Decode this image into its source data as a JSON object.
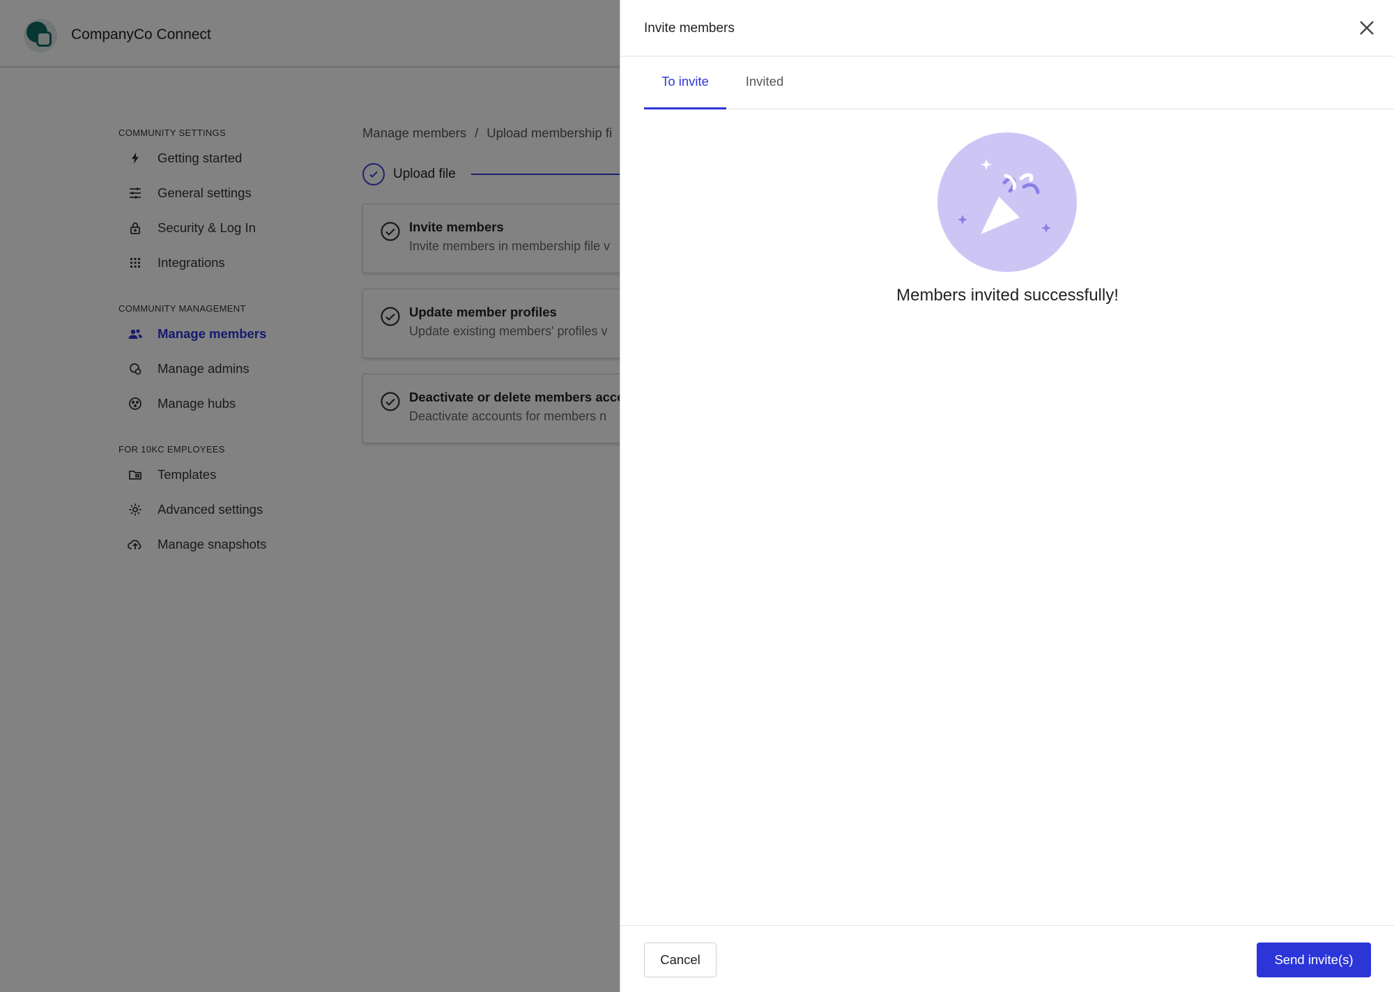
{
  "app": {
    "title": "CompanyCo Connect",
    "logo_icon": "chat-bubbles-logo",
    "accent_color": "#2c35d8"
  },
  "sidebar": {
    "sections": [
      {
        "heading": "COMMUNITY SETTINGS",
        "items": [
          {
            "label": "Getting started",
            "icon": "lightning-icon"
          },
          {
            "label": "General settings",
            "icon": "sliders-icon"
          },
          {
            "label": "Security & Log In",
            "icon": "lock-icon"
          },
          {
            "label": "Integrations",
            "icon": "grid-icon"
          }
        ]
      },
      {
        "heading": "COMMUNITY MANAGEMENT",
        "items": [
          {
            "label": "Manage members",
            "icon": "users-icon",
            "active": true
          },
          {
            "label": "Manage admins",
            "icon": "admin-badge-icon"
          },
          {
            "label": "Manage hubs",
            "icon": "hub-icon"
          }
        ]
      },
      {
        "heading": "FOR 10KC EMPLOYEES",
        "items": [
          {
            "label": "Templates",
            "icon": "folder-icon"
          },
          {
            "label": "Advanced settings",
            "icon": "gear-icon"
          },
          {
            "label": "Manage snapshots",
            "icon": "cloud-upload-icon"
          }
        ]
      }
    ]
  },
  "main": {
    "breadcrumb": [
      "Manage members",
      "/",
      "Upload membership fi"
    ],
    "stepper": {
      "current_step": "Upload file"
    },
    "cards": [
      {
        "title": "Invite members",
        "subtitle": "Invite members in membership file v"
      },
      {
        "title": "Update member profiles",
        "subtitle": "Update existing members' profiles v"
      },
      {
        "title": "Deactivate or delete members acco",
        "subtitle": "Deactivate accounts for members n"
      }
    ]
  },
  "drawer": {
    "title": "Invite members",
    "close_icon": "close-icon",
    "tabs": [
      {
        "label": "To invite",
        "active": true
      },
      {
        "label": "Invited",
        "active": false
      }
    ],
    "illustration_icon": "party-popper-icon",
    "success_message": "Members invited successfully!",
    "footer": {
      "cancel_label": "Cancel",
      "send_label": "Send invite(s)"
    }
  }
}
